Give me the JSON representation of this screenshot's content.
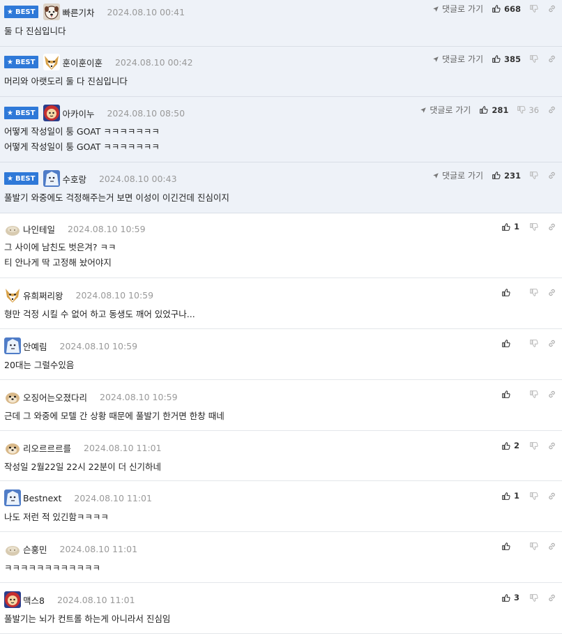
{
  "labels": {
    "best": "BEST",
    "goto": "댓글로 가기"
  },
  "icons": {
    "best_star": "★",
    "goto_arrow": "➤",
    "thumb_up": "👍",
    "thumb_down": "👎",
    "link": "🔗"
  },
  "colors": {
    "best_badge": "#2f79d8",
    "best_background": "#eef2f8",
    "date": "#999999"
  },
  "comments": [
    {
      "best": true,
      "avatar": "dog-face",
      "nickname": "빠른기차",
      "date": "2024.08.10 00:41",
      "text": [
        "둘 다 진심입니다"
      ],
      "up": "668",
      "down": ""
    },
    {
      "best": true,
      "avatar": "fox-face",
      "nickname": "훈이훈이훈",
      "date": "2024.08.10 00:42",
      "text": [
        "머리와 아랫도리 둘 다 진심입니다"
      ],
      "up": "385",
      "down": ""
    },
    {
      "best": true,
      "avatar": "lion-face",
      "nickname": "아카이누",
      "date": "2024.08.10 08:50",
      "text": [
        "어떻게 작성일이 퉁 GOAT ㅋㅋㅋㅋㅋㅋㅋ",
        "어떻게 작성일이 퉁 GOAT ㅋㅋㅋㅋㅋㅋㅋ"
      ],
      "up": "281",
      "down": "36"
    },
    {
      "best": true,
      "avatar": "ice-face",
      "nickname": "수호랑",
      "date": "2024.08.10 00:43",
      "text": [
        "풀발기 와중에도 걱정해주는거 보면 이성이 이긴건데 진심이지"
      ],
      "up": "231",
      "down": ""
    },
    {
      "best": false,
      "avatar": "blob-face",
      "nickname": "나인테일",
      "date": "2024.08.10 10:59",
      "text": [
        "그 사이에 남친도 벗은겨? ㅋㅋ",
        "티 안나게 딱 고정해 놨어야지"
      ],
      "up": "1",
      "down": ""
    },
    {
      "best": false,
      "avatar": "fox-face",
      "nickname": "유희쩌리왕",
      "date": "2024.08.10 10:59",
      "text": [
        "형만 걱정 시킬 수 없어 하고 동생도 깨어 있었구나..."
      ],
      "up": "",
      "down": ""
    },
    {
      "best": false,
      "avatar": "ice-face",
      "nickname": "안예림",
      "date": "2024.08.10 10:59",
      "text": [
        "20대는 그럴수있음"
      ],
      "up": "",
      "down": ""
    },
    {
      "best": false,
      "avatar": "doge-face",
      "nickname": "오징어는오졌다리",
      "date": "2024.08.10 10:59",
      "text": [
        "근데 그 와중에 모텔 간 상황 때문에 풀발기 한거면 한창 때네"
      ],
      "up": "",
      "down": ""
    },
    {
      "best": false,
      "avatar": "doge-face",
      "nickname": "리오르르르를",
      "date": "2024.08.10 11:01",
      "text": [
        "작성일 2월22일 22시 22분이 더 신기하네"
      ],
      "up": "2",
      "down": ""
    },
    {
      "best": false,
      "avatar": "ice-face",
      "nickname": "Bestnext",
      "date": "2024.08.10 11:01",
      "text": [
        "나도 저런 적 있긴함ㅋㅋㅋㅋ"
      ],
      "up": "1",
      "down": ""
    },
    {
      "best": false,
      "avatar": "blob-face",
      "nickname": "슨훙민",
      "date": "2024.08.10 11:01",
      "text": [
        "ㅋㅋㅋㅋㅋㅋㅋㅋㅋㅋㅋㅋ"
      ],
      "up": "",
      "down": ""
    },
    {
      "best": false,
      "avatar": "lion-face",
      "nickname": "맥스8",
      "date": "2024.08.10 11:01",
      "text": [
        "풀발기는 뇌가 컨트롤 하는게 아니라서 진심임"
      ],
      "up": "3",
      "down": ""
    }
  ]
}
